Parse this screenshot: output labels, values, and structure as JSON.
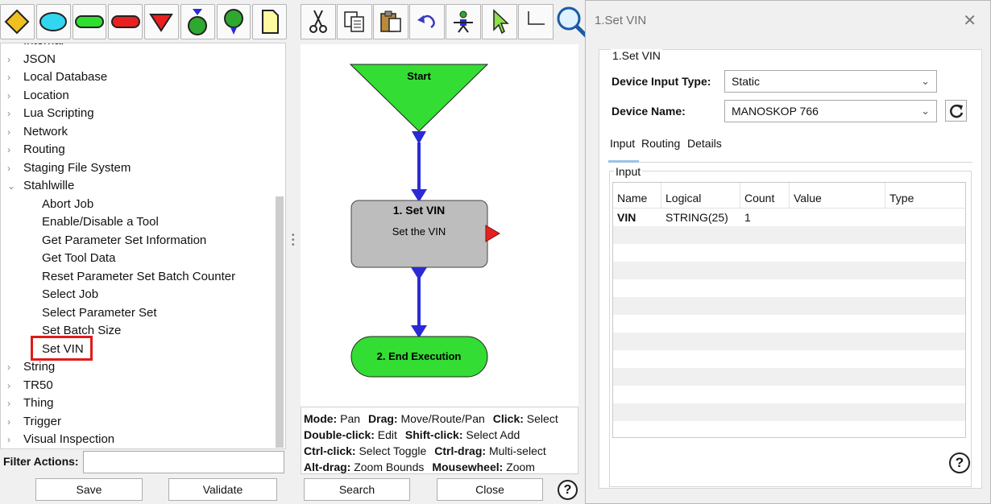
{
  "tree": {
    "partial_top": "Internal",
    "categories_before": [
      "JSON",
      "Local Database",
      "Location",
      "Lua Scripting",
      "Network",
      "Routing",
      "Staging File System"
    ],
    "expanded": "Stahlwille",
    "children": [
      "Abort Job",
      "Enable/Disable a Tool",
      "Get Parameter Set Information",
      "Get Tool Data",
      "Reset Parameter Set Batch Counter",
      "Select Job",
      "Select Parameter Set",
      "Set Batch Size",
      "Set VIN"
    ],
    "categories_after": [
      "String",
      "TR50",
      "Thing",
      "Trigger",
      "Visual Inspection"
    ]
  },
  "filter": {
    "label": "Filter Actions:",
    "value": ""
  },
  "buttons": {
    "save": "Save",
    "validate": "Validate",
    "search": "Search",
    "close": "Close"
  },
  "shape_toolbar": [
    "diamond-icon",
    "oval-icon",
    "green-terminator-icon",
    "red-terminator-icon",
    "red-triangle-icon",
    "green-circle-arrow-icon",
    "green-pin-icon",
    "note-icon"
  ],
  "edit_toolbar": [
    "cut-icon",
    "copy-icon",
    "paste-icon",
    "undo-icon",
    "layout-icon",
    "pointer-icon",
    "route-icon",
    "zoom-icon"
  ],
  "flow": {
    "start": "Start",
    "step1_title": "1. Set VIN",
    "step1_subtitle": "Set the VIN",
    "end": "2. End Execution"
  },
  "mode_help": [
    [
      {
        "k": "Mode:",
        "v": "Pan"
      },
      {
        "k": "Drag:",
        "v": "Move/Route/Pan"
      },
      {
        "k": "Click:",
        "v": "Select"
      }
    ],
    [
      {
        "k": "Double-click:",
        "v": "Edit"
      },
      {
        "k": "Shift-click:",
        "v": "Select Add"
      }
    ],
    [
      {
        "k": "Ctrl-click:",
        "v": "Select Toggle"
      },
      {
        "k": "Ctrl-drag:",
        "v": "Multi-select"
      }
    ],
    [
      {
        "k": "Alt-drag:",
        "v": "Zoom Bounds"
      },
      {
        "k": "Mousewheel:",
        "v": "Zoom"
      }
    ]
  ],
  "dialog": {
    "title": "1.Set VIN",
    "group_title": "1.Set VIN",
    "device_input_type_label": "Device Input Type:",
    "device_input_type_value": "Static",
    "device_name_label": "Device Name:",
    "device_name_value": "MANOSKOP 766",
    "tabs": [
      "Input",
      "Routing",
      "Details"
    ],
    "active_tab": "Input",
    "input_group_title": "Input",
    "columns": [
      "Name",
      "Logical",
      "Count",
      "Value",
      "Type"
    ],
    "rows": [
      {
        "name": "VIN",
        "logical": "STRING(25)",
        "count": "1",
        "value": "",
        "type": ""
      }
    ],
    "help": "?"
  },
  "colors": {
    "start_fill": "#33dd33",
    "step_fill": "#bdbdbd",
    "end_fill": "#33dd33",
    "connector": "#2a2ad6",
    "highlight": "#e01b1b"
  }
}
